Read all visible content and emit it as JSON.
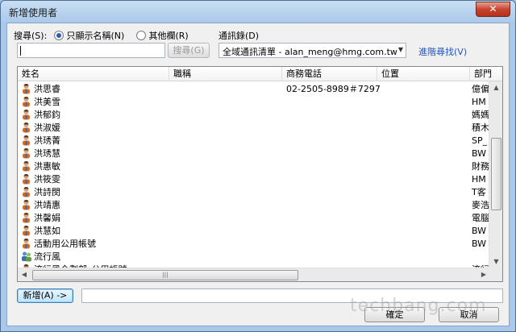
{
  "window": {
    "title": "新增使用者",
    "close_glyph": "✕"
  },
  "search": {
    "label": "搜尋(S):",
    "option_name_only": "只顯示名稱(N)",
    "option_other": "其他欄(R)",
    "selected": "name_only",
    "input_value": "",
    "button": "搜尋(G)"
  },
  "address_book": {
    "label": "通訊錄(D)",
    "selected": "全域通訊清單 - alan_meng@hmg.com.tw",
    "advanced_link": "進階尋找(V)"
  },
  "table": {
    "columns": [
      "姓名",
      "職稱",
      "商務電話",
      "位置",
      "部門"
    ],
    "rows": [
      {
        "icon": "person-icon",
        "name": "洪思睿",
        "title": "",
        "phone": "02-2505-8989＃7297",
        "location": "",
        "dept": "億偏"
      },
      {
        "icon": "person-icon",
        "name": "洪美雪",
        "title": "",
        "phone": "",
        "location": "",
        "dept": "HM"
      },
      {
        "icon": "person-icon",
        "name": "洪郁鈞",
        "title": "",
        "phone": "",
        "location": "",
        "dept": "媽媽"
      },
      {
        "icon": "person-icon",
        "name": "洪淑媛",
        "title": "",
        "phone": "",
        "location": "",
        "dept": "積木"
      },
      {
        "icon": "person-icon",
        "name": "洪琇菁",
        "title": "",
        "phone": "",
        "location": "",
        "dept": "SP_"
      },
      {
        "icon": "person-icon",
        "name": "洪琇慧",
        "title": "",
        "phone": "",
        "location": "",
        "dept": "BW"
      },
      {
        "icon": "person-icon",
        "name": "洪惠敏",
        "title": "",
        "phone": "",
        "location": "",
        "dept": "財務"
      },
      {
        "icon": "person-icon",
        "name": "洪筱雯",
        "title": "",
        "phone": "",
        "location": "",
        "dept": "HM"
      },
      {
        "icon": "person-icon",
        "name": "洪詩閔",
        "title": "",
        "phone": "",
        "location": "",
        "dept": "T客"
      },
      {
        "icon": "person-icon",
        "name": "洪靖惠",
        "title": "",
        "phone": "",
        "location": "",
        "dept": "麥浩"
      },
      {
        "icon": "person-icon",
        "name": "洪馨娟",
        "title": "",
        "phone": "",
        "location": "",
        "dept": "電腦"
      },
      {
        "icon": "person-icon",
        "name": "洪慧如",
        "title": "",
        "phone": "",
        "location": "",
        "dept": "BW"
      },
      {
        "icon": "person-icon",
        "name": "活動用公用帳號",
        "title": "",
        "phone": "",
        "location": "",
        "dept": "BW"
      },
      {
        "icon": "group-icon",
        "name": "流行風",
        "title": "",
        "phone": "",
        "location": "",
        "dept": ""
      },
      {
        "icon": "person-icon",
        "name": "流行風企劃部_公用帳號",
        "title": "",
        "phone": "",
        "location": "",
        "dept": "流行"
      }
    ]
  },
  "add": {
    "button": "新增(A) ->",
    "value": ""
  },
  "footer": {
    "ok": "確定",
    "cancel": "取消"
  },
  "watermark": {
    "text": "techbang.com"
  }
}
